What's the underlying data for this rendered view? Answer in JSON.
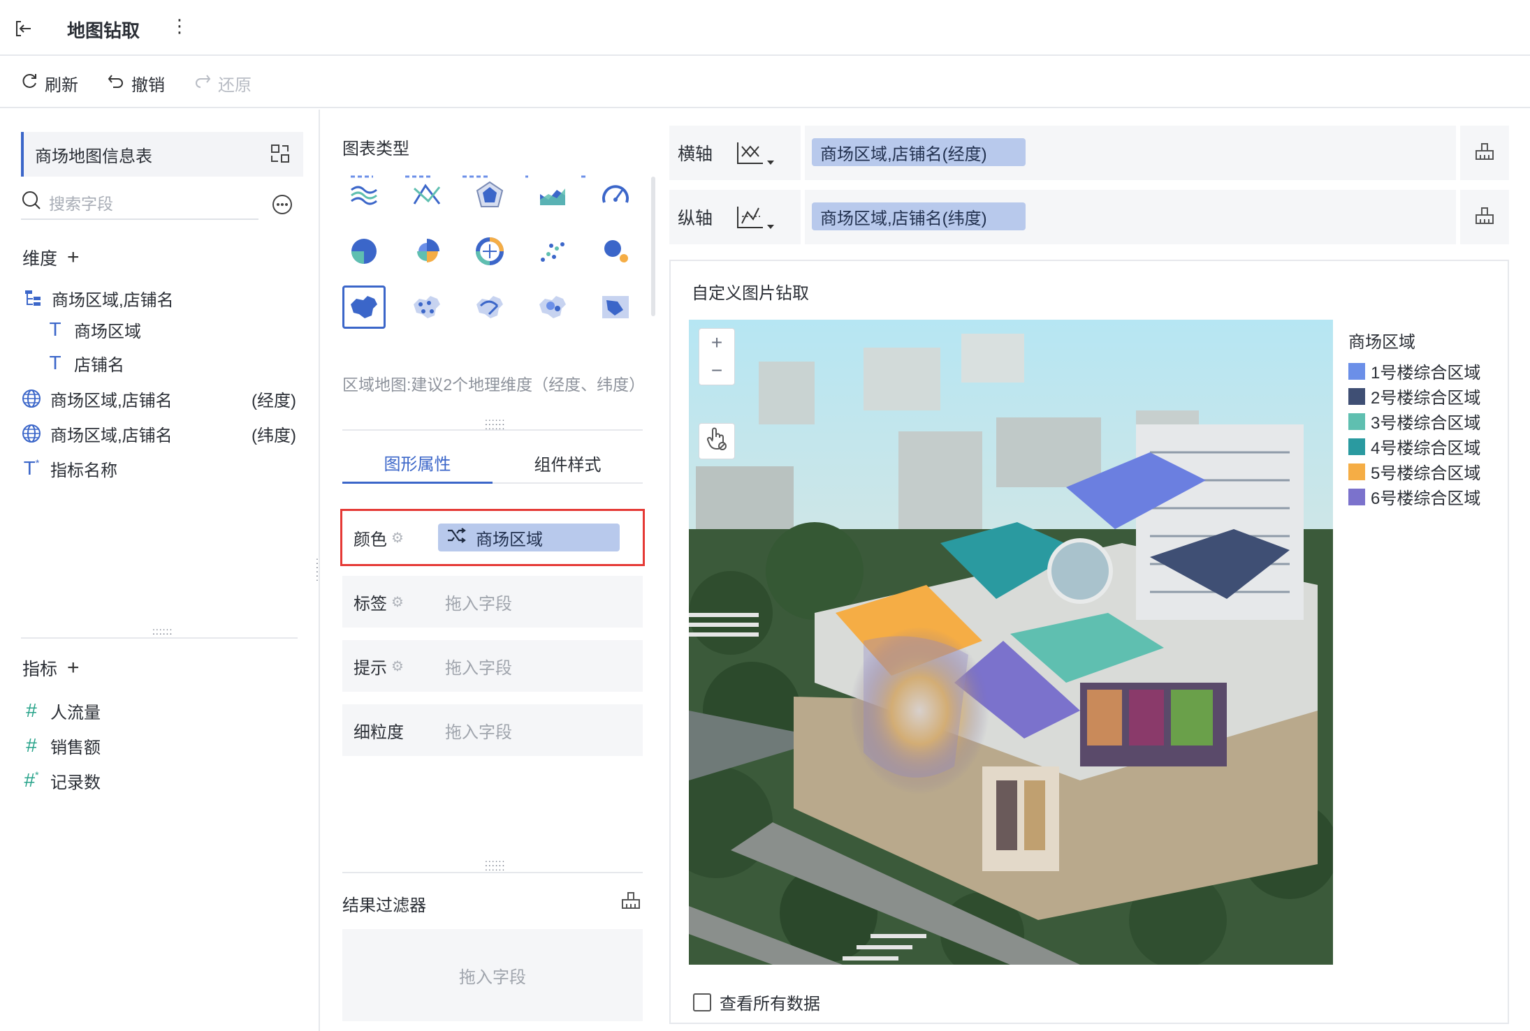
{
  "header": {
    "title": "地图钻取"
  },
  "toolbar": {
    "refresh": "刷新",
    "undo": "撤销",
    "redo": "还原"
  },
  "left": {
    "dataset": "商场地图信息表",
    "search_placeholder": "搜索字段",
    "dimension_title": "维度",
    "dimensions": [
      {
        "label": "商场区域,店铺名",
        "icon": "hierarchy-icon"
      },
      {
        "label": "商场区域",
        "icon": "text-type-icon"
      },
      {
        "label": "店铺名",
        "icon": "text-type-icon"
      },
      {
        "label": "商场区域,店铺名",
        "suffix": "(经度)",
        "icon": "globe-icon"
      },
      {
        "label": "商场区域,店铺名",
        "suffix": "(纬度)",
        "icon": "globe-icon"
      },
      {
        "label": "指标名称",
        "icon": "text-star-icon"
      }
    ],
    "measure_title": "指标",
    "measures": [
      {
        "label": "人流量",
        "icon": "hash-icon"
      },
      {
        "label": "销售额",
        "icon": "hash-icon"
      },
      {
        "label": "记录数",
        "icon": "hash-star-icon"
      }
    ]
  },
  "middle": {
    "chart_type_title": "图表类型",
    "chart_hint": "区域地图:建议2个地理维度（经度、纬度）",
    "tabs": [
      "图形属性",
      "组件样式"
    ],
    "props": [
      {
        "label": "颜色",
        "value": "商场区域"
      },
      {
        "label": "标签",
        "value": "拖入字段"
      },
      {
        "label": "提示",
        "value": "拖入字段"
      },
      {
        "label": "细粒度",
        "value": "拖入字段"
      }
    ],
    "filter_title": "结果过滤器",
    "filter_placeholder": "拖入字段"
  },
  "axes": {
    "x_label": "横轴",
    "x_field": "商场区域,店铺名(经度)",
    "y_label": "纵轴",
    "y_field": "商场区域,店铺名(纬度)"
  },
  "canvas": {
    "title": "自定义图片钻取",
    "legend_title": "商场区域",
    "legend": [
      {
        "label": "1号楼综合区域",
        "color": "#6b8fe8"
      },
      {
        "label": "2号楼综合区域",
        "color": "#3f4f74"
      },
      {
        "label": "3号楼综合区域",
        "color": "#5fbfb0"
      },
      {
        "label": "4号楼综合区域",
        "color": "#2a9aa0"
      },
      {
        "label": "5号楼综合区域",
        "color": "#f5ad45"
      },
      {
        "label": "6号楼综合区域",
        "color": "#7b72cc"
      }
    ],
    "view_all": "查看所有数据"
  },
  "colors": {
    "accent": "#3b66c9",
    "highlight": "#e53935",
    "pill": "#b8c9ec"
  }
}
